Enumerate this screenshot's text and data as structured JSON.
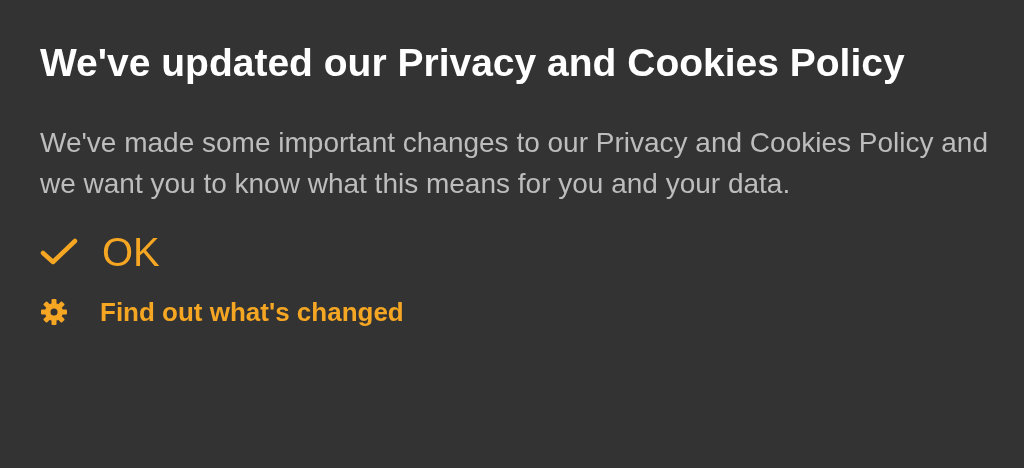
{
  "dialog": {
    "title": "We've updated our Privacy and Cookies Policy",
    "message": "We've made some important changes to our Privacy and Cookies Policy and we want you to know what this means for you and your data.",
    "actions": [
      {
        "kind": "confirm",
        "label": "OK"
      },
      {
        "kind": "link",
        "label": "Find out what's changed"
      }
    ]
  }
}
